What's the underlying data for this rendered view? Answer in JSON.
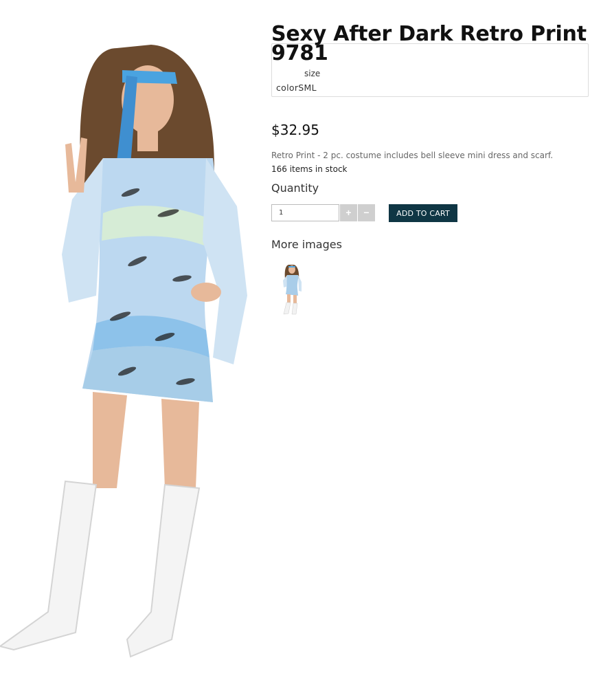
{
  "product": {
    "title": "Sexy After Dark Retro Print 9781",
    "price": "$32.95",
    "description": "Retro Print - 2 pc. costume includes bell sleeve mini dress and scarf.",
    "stock": "166 items in stock"
  },
  "options": {
    "size_label": "size",
    "color_row": "colorSML"
  },
  "quantity": {
    "label": "Quantity",
    "value": "1",
    "plus": "+",
    "minus": "−"
  },
  "cart": {
    "add_label": "ADD TO CART"
  },
  "gallery": {
    "label": "More images",
    "thumbnails": [
      "product-thumbnail"
    ]
  },
  "colors": {
    "cart_button": "#0f3644",
    "stepper": "#cfcfcf"
  }
}
